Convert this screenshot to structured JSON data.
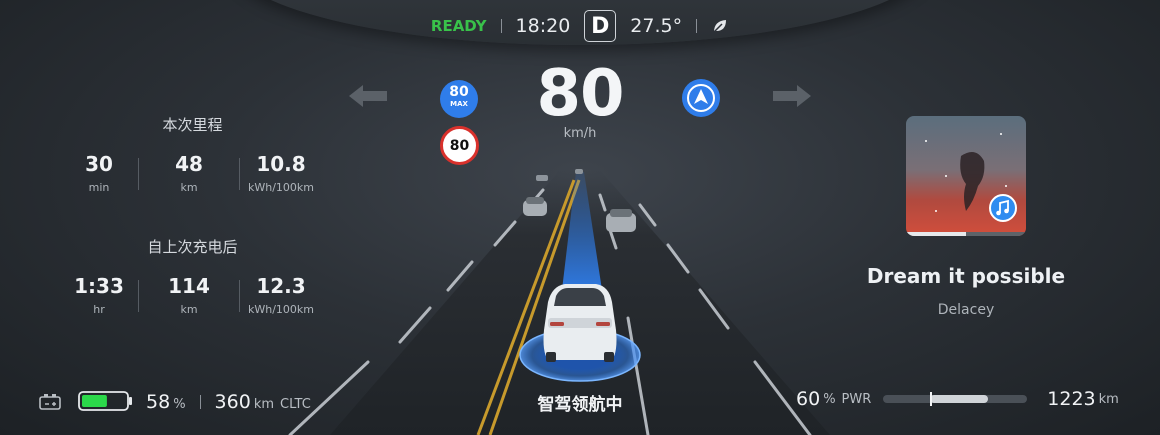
{
  "status_bar": {
    "ready_label": "READY",
    "time": "18:20",
    "gear": "D",
    "temperature": "27.5°",
    "eco_icon": "leaf-icon"
  },
  "speed": {
    "value": "80",
    "unit": "km/h",
    "max_speed_value": "80",
    "max_speed_label": "MAX",
    "speed_limit": "80"
  },
  "trip": {
    "title": "本次里程",
    "stats": [
      {
        "value": "30",
        "unit": "min"
      },
      {
        "value": "48",
        "unit": "km"
      },
      {
        "value": "10.8",
        "unit": "kWh/100km"
      }
    ]
  },
  "since_charge": {
    "title": "自上次充电后",
    "stats": [
      {
        "value": "1:33",
        "unit": "hr"
      },
      {
        "value": "114",
        "unit": "km"
      },
      {
        "value": "12.3",
        "unit": "kWh/100km"
      }
    ]
  },
  "battery": {
    "percent": "58",
    "percent_unit": "%",
    "range": "360",
    "range_unit": "km",
    "range_standard": "CLTC",
    "level_fraction": 0.58
  },
  "power": {
    "percent": "60",
    "percent_unit": "%",
    "label": "PWR",
    "odometer": "1223",
    "odometer_unit": "km",
    "level_fraction": 0.6
  },
  "media": {
    "song_title": "Dream it possible",
    "artist": "Delacey",
    "progress_fraction": 0.5,
    "app_icon": "music-note-icon"
  },
  "driving": {
    "mode_label": "智驾领航中"
  },
  "colors": {
    "ready_green": "#39c24a",
    "accent_blue": "#2f7dea",
    "battery_green": "#2bd84a",
    "limit_red": "#d9312c"
  }
}
